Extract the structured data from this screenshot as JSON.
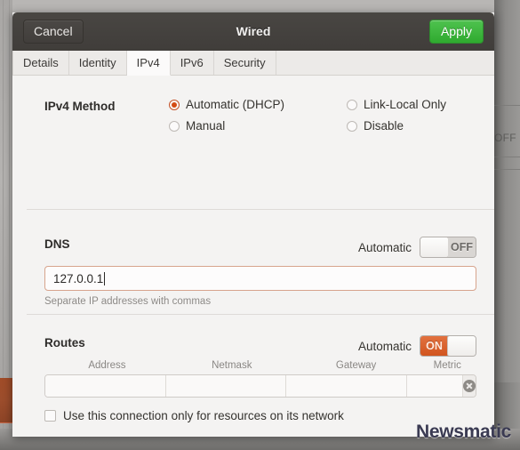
{
  "window": {
    "title": "Wired",
    "cancel_label": "Cancel",
    "apply_label": "Apply",
    "accent_orange": "#d44a14",
    "apply_green": "#3fb63f",
    "titlebar_color": "#443f3c"
  },
  "tabs": [
    {
      "label": "Details",
      "active": false
    },
    {
      "label": "Identity",
      "active": false
    },
    {
      "label": "IPv4",
      "active": true
    },
    {
      "label": "IPv6",
      "active": false
    },
    {
      "label": "Security",
      "active": false
    }
  ],
  "ipv4_method": {
    "label": "IPv4 Method",
    "options": [
      {
        "label": "Automatic (DHCP)",
        "selected": true
      },
      {
        "label": "Link-Local Only",
        "selected": false
      },
      {
        "label": "Manual",
        "selected": false
      },
      {
        "label": "Disable",
        "selected": false
      }
    ]
  },
  "dns": {
    "label": "DNS",
    "automatic_label": "Automatic",
    "toggle_state": "OFF",
    "value": "127.0.0.1",
    "placeholder": "",
    "hint": "Separate IP addresses with commas"
  },
  "routes": {
    "label": "Routes",
    "automatic_label": "Automatic",
    "toggle_state": "ON",
    "columns": [
      "Address",
      "Netmask",
      "Gateway",
      "Metric"
    ],
    "rows": [
      {
        "address": "",
        "netmask": "",
        "gateway": "",
        "metric": ""
      }
    ],
    "delete_icon": "close-circle-icon"
  },
  "restrict_checkbox": {
    "label": "Use this connection only for resources on its network",
    "checked": false
  },
  "background": {
    "right_panel_text": "OFF"
  },
  "watermark": {
    "text": "Newsmatic"
  }
}
